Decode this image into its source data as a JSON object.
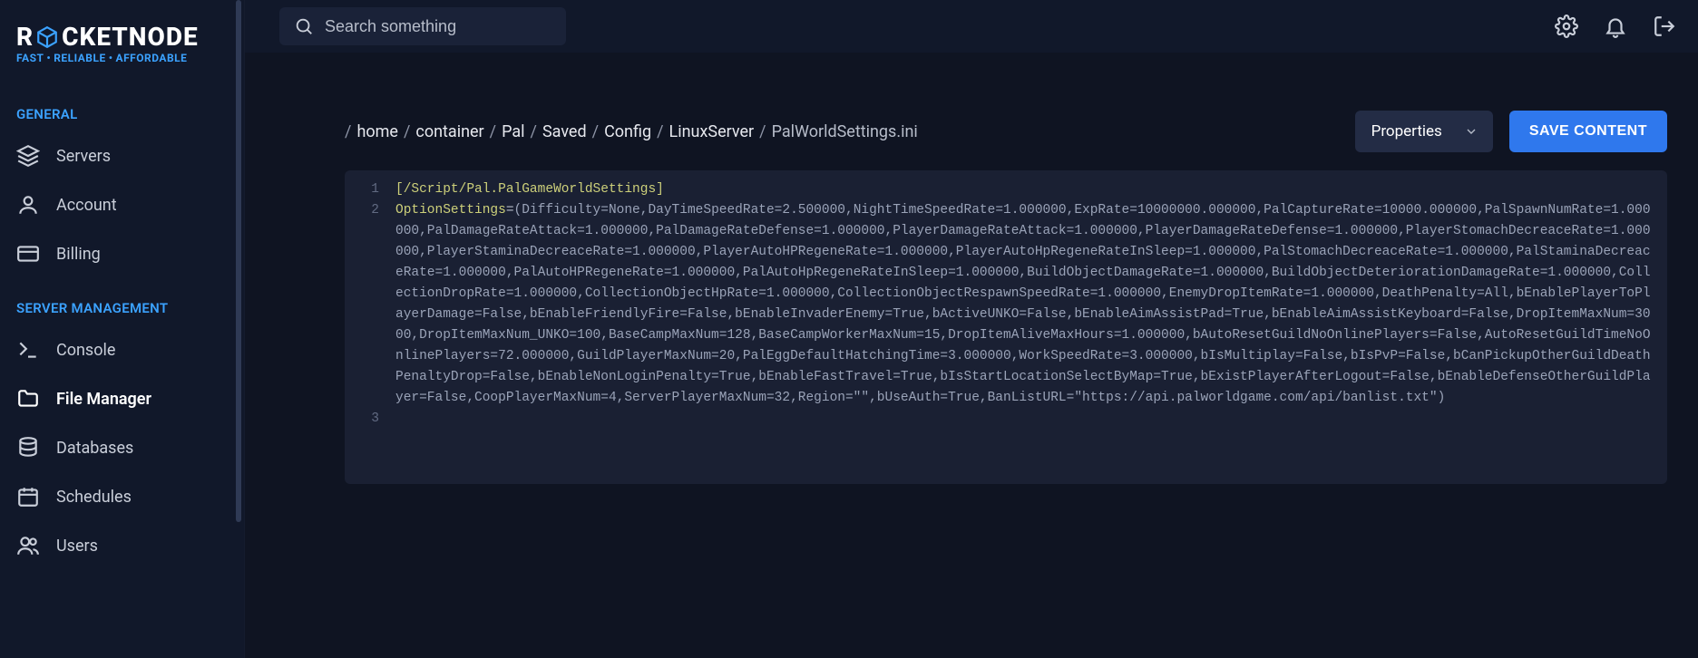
{
  "brand": {
    "pre": "R",
    "post": "CKETNODE",
    "tagline_parts": [
      "FAST",
      "RELIABLE",
      "AFFORDABLE"
    ]
  },
  "search": {
    "placeholder": "Search something"
  },
  "sidebar": {
    "sections": {
      "general": {
        "title": "GENERAL",
        "items": [
          "Servers",
          "Account",
          "Billing"
        ]
      },
      "server_mgmt": {
        "title": "SERVER MANAGEMENT",
        "items": [
          "Console",
          "File Manager",
          "Databases",
          "Schedules",
          "Users"
        ]
      }
    },
    "active": "File Manager"
  },
  "breadcrumb": [
    "home",
    "container",
    "Pal",
    "Saved",
    "Config",
    "LinuxServer",
    "PalWorldSettings.ini"
  ],
  "dropdown": {
    "selected": "Properties"
  },
  "save_label": "SAVE CONTENT",
  "editor": {
    "lines": {
      "1": {
        "section": "[/Script/Pal.PalGameWorldSettings]"
      },
      "2": {
        "key": "OptionSettings",
        "eq": "=",
        "rest": "(Difficulty=None,DayTimeSpeedRate=2.500000,NightTimeSpeedRate=1.000000,ExpRate=10000000.000000,PalCaptureRate=10000.000000,PalSpawnNumRate=1.000000,PalDamageRateAttack=1.000000,PalDamageRateDefense=1.000000,PlayerDamageRateAttack=1.000000,PlayerDamageRateDefense=1.000000,PlayerStomachDecreaceRate=1.000000,PlayerStaminaDecreaceRate=1.000000,PlayerAutoHPRegeneRate=1.000000,PlayerAutoHpRegeneRateInSleep=1.000000,PalStomachDecreaceRate=1.000000,PalStaminaDecreaceRate=1.000000,PalAutoHPRegeneRate=1.000000,PalAutoHpRegeneRateInSleep=1.000000,BuildObjectDamageRate=1.000000,BuildObjectDeteriorationDamageRate=1.000000,CollectionDropRate=1.000000,CollectionObjectHpRate=1.000000,CollectionObjectRespawnSpeedRate=1.000000,EnemyDropItemRate=1.000000,DeathPenalty=All,bEnablePlayerToPlayerDamage=False,bEnableFriendlyFire=False,bEnableInvaderEnemy=True,bActiveUNKO=False,bEnableAimAssistPad=True,bEnableAimAssistKeyboard=False,DropItemMaxNum=3000,DropItemMaxNum_UNKO=100,BaseCampMaxNum=128,BaseCampWorkerMaxNum=15,DropItemAliveMaxHours=1.000000,bAutoResetGuildNoOnlinePlayers=False,AutoResetGuildTimeNoOnlinePlayers=72.000000,GuildPlayerMaxNum=20,PalEggDefaultHatchingTime=3.000000,WorkSpeedRate=3.000000,bIsMultiplay=False,bIsPvP=False,bCanPickupOtherGuildDeathPenaltyDrop=False,bEnableNonLoginPenalty=True,bEnableFastTravel=True,bIsStartLocationSelectByMap=True,bExistPlayerAfterLogout=False,bEnableDefenseOtherGuildPlayer=False,CoopPlayerMaxNum=4,ServerPlayerMaxNum=32,Region=\"\",bUseAuth=True,BanListURL=\"https://api.palworldgame.com/api/banlist.txt\")"
      },
      "3": ""
    }
  }
}
